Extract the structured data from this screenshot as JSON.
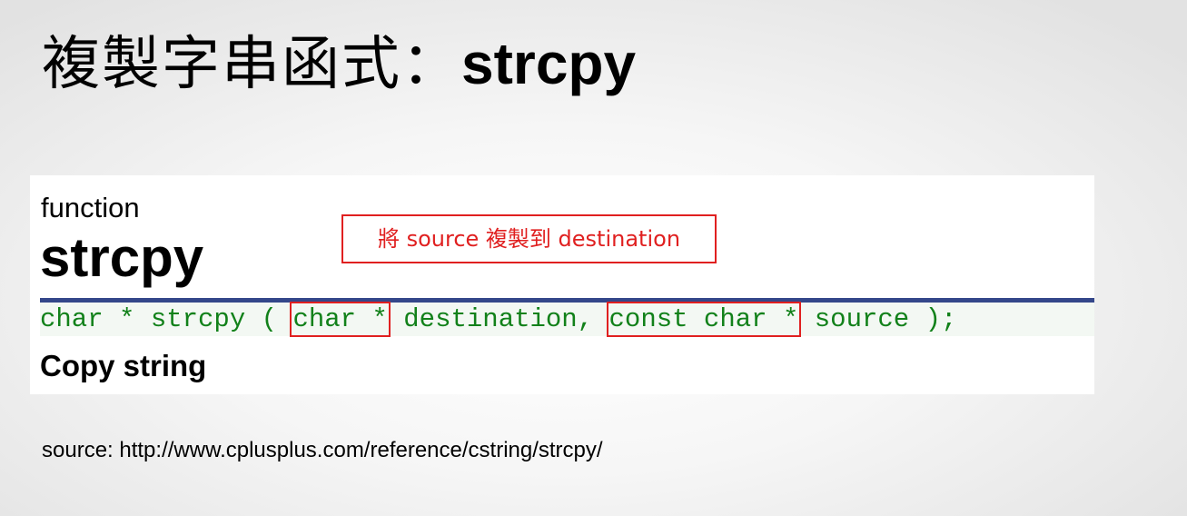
{
  "slide": {
    "title_cn": "複製字串函式：",
    "title_en": "strcpy"
  },
  "reference": {
    "kind": "function",
    "name": "strcpy",
    "callout": "將 source 複製到 destination",
    "prototype": {
      "return_part": "char * strcpy ( ",
      "param1_type": "char *",
      "param1_name": " destination, ",
      "param2_type": "const char *",
      "param2_name": " source );"
    },
    "summary": "Copy string"
  },
  "footer": {
    "source": "source: http://www.cplusplus.com/reference/cstring/strcpy/"
  },
  "colors": {
    "code_green": "#12811a",
    "highlight_red": "#e02020",
    "rule_blue": "#34478a"
  }
}
